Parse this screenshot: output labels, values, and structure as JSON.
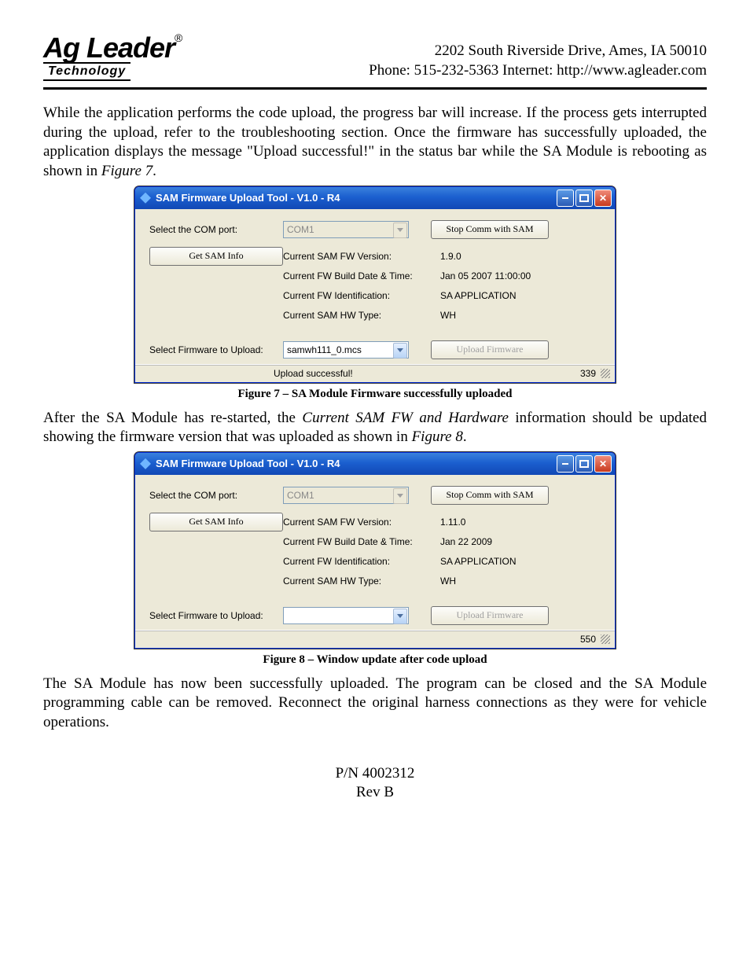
{
  "header": {
    "logo_main": "Ag Leader",
    "logo_reg": "®",
    "logo_sub": "Technology",
    "addr": "2202 South Riverside Drive, Ames, IA  50010",
    "contact": "Phone: 515-232-5363 Internet:  http://www.agleader.com"
  },
  "para1_a": "While the application performs the code upload, the progress bar will increase. If the process gets interrupted during the upload, refer to the troubleshooting section. Once the firmware has successfully uploaded, the application displays the message \"Upload successful!\" in the status bar while the SA Module is rebooting as shown in ",
  "para1_i": "Figure 7",
  "para1_b": ".",
  "fig7": {
    "title": "SAM Firmware Upload Tool - V1.0 - R4",
    "lbl_com": "Select the COM port:",
    "combo_com": "COM1",
    "btn_stop": "Stop Comm with SAM",
    "btn_getinfo": "Get SAM Info",
    "l1": "Current SAM FW Version:",
    "l2": "Current FW Build Date & Time:",
    "l3": "Current FW Identification:",
    "l4": "Current SAM HW Type:",
    "v1": "1.9.0",
    "v2": "Jan 05 2007 11:00:00",
    "v3": "SA APPLICATION",
    "v4": "WH",
    "lbl_fw": "Select Firmware to Upload:",
    "combo_fw": "samwh111_0.mcs",
    "btn_upload": "Upload Firmware",
    "status_msg": "Upload successful!",
    "status_num": "339",
    "caption": "Figure 7 – SA Module Firmware successfully uploaded"
  },
  "para2_a": "After the SA Module has re-started, the ",
  "para2_i": "Current SAM FW and Hardware",
  "para2_b": " information should be updated showing the firmware version that was uploaded as shown in ",
  "para2_i2": "Figure 8",
  "para2_c": ".",
  "fig8": {
    "title": "SAM Firmware Upload Tool - V1.0 - R4",
    "lbl_com": "Select the COM port:",
    "combo_com": "COM1",
    "btn_stop": "Stop Comm with SAM",
    "btn_getinfo": "Get SAM Info",
    "l1": "Current SAM FW Version:",
    "l2": "Current FW Build Date & Time:",
    "l3": "Current FW Identification:",
    "l4": "Current SAM HW Type:",
    "v1": "1.11.0",
    "v2": "Jan 22 2009",
    "v3": "SA APPLICATION",
    "v4": "WH",
    "lbl_fw": "Select Firmware to Upload:",
    "combo_fw": "",
    "btn_upload": "Upload Firmware",
    "status_msg": "",
    "status_num": "550",
    "caption": "Figure 8 – Window update after code upload"
  },
  "para3": "The SA Module has now been successfully uploaded. The program can be closed and the SA Module programming cable can be removed. Reconnect the original harness connections as they were for vehicle operations.",
  "footer_pn": "P/N 4002312",
  "footer_rev": "Rev B"
}
